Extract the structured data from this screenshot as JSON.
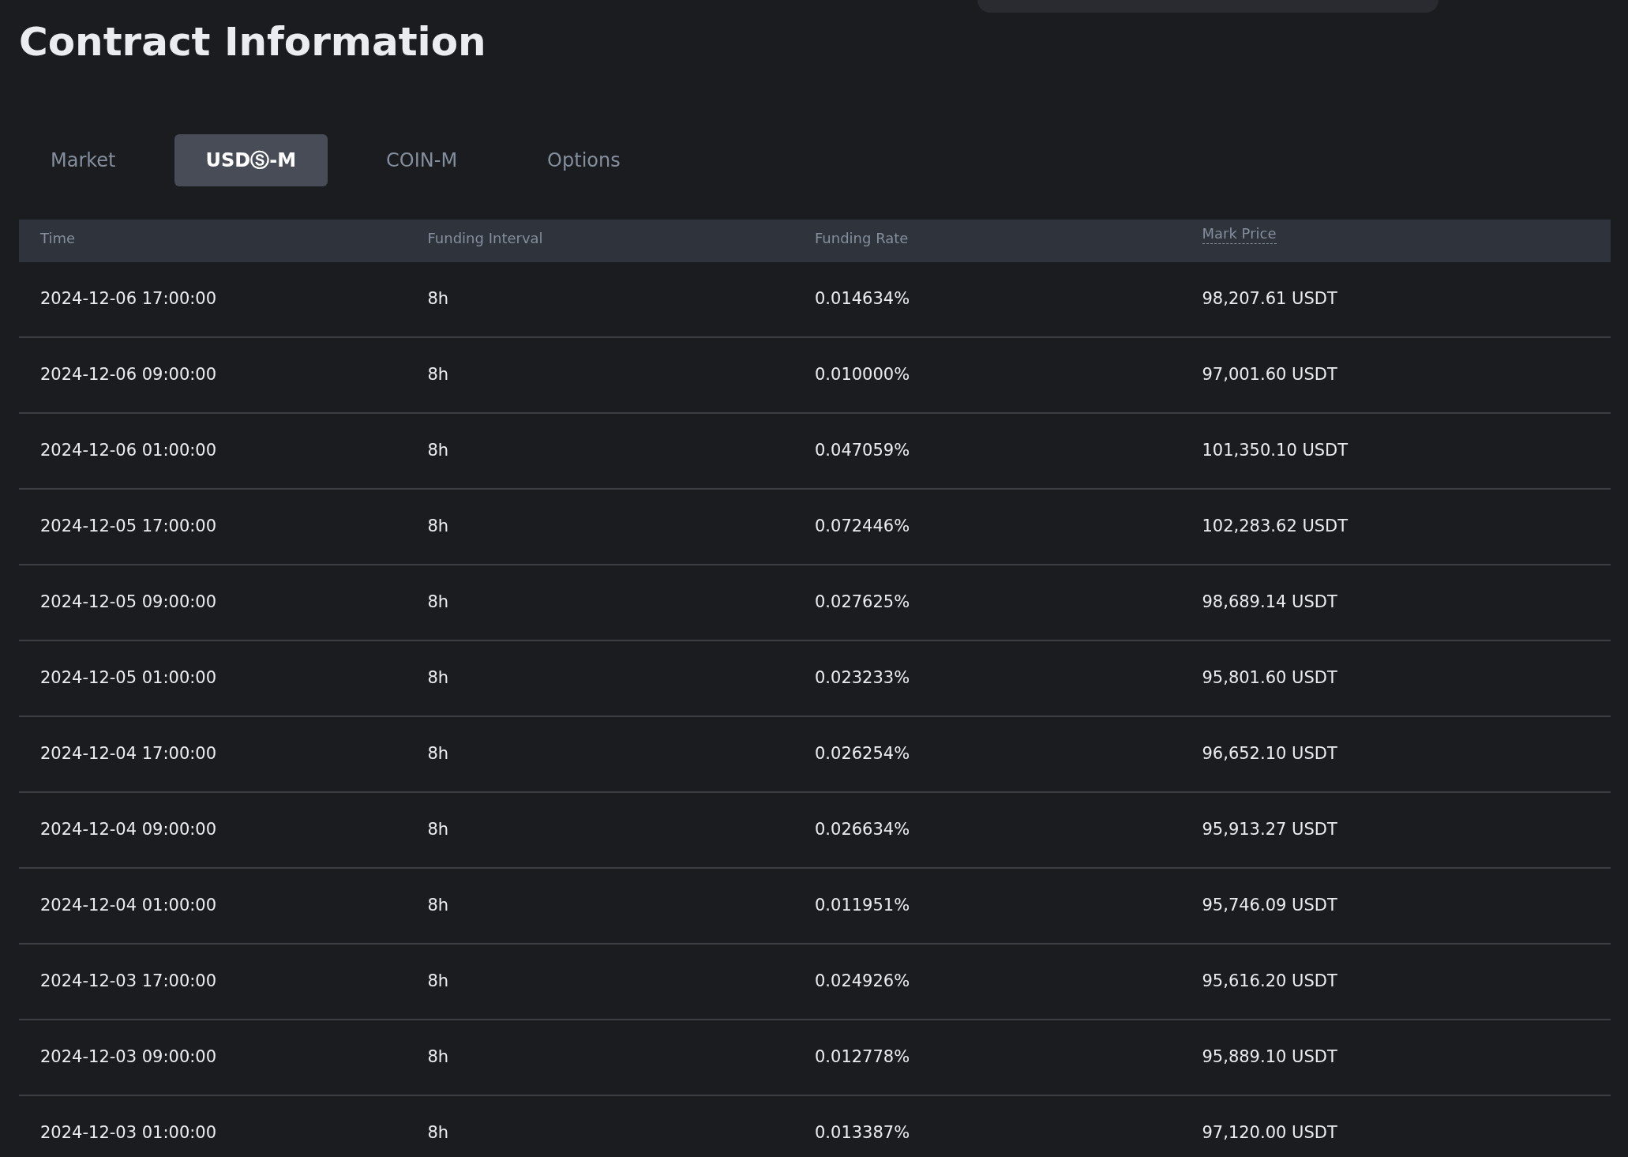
{
  "title": "Contract Information",
  "tabs": [
    {
      "label": "Market",
      "selected": false
    },
    {
      "label": "USDⓈ-M",
      "selected": true
    },
    {
      "label": "COIN-M",
      "selected": false
    },
    {
      "label": "Options",
      "selected": false
    }
  ],
  "table": {
    "columns": [
      "Time",
      "Funding Interval",
      "Funding Rate",
      "Mark Price"
    ],
    "rows": [
      [
        "2024-12-06 17:00:00",
        "8h",
        "0.014634%",
        "98,207.61 USDT"
      ],
      [
        "2024-12-06 09:00:00",
        "8h",
        "0.010000%",
        "97,001.60 USDT"
      ],
      [
        "2024-12-06 01:00:00",
        "8h",
        "0.047059%",
        "101,350.10 USDT"
      ],
      [
        "2024-12-05 17:00:00",
        "8h",
        "0.072446%",
        "102,283.62 USDT"
      ],
      [
        "2024-12-05 09:00:00",
        "8h",
        "0.027625%",
        "98,689.14 USDT"
      ],
      [
        "2024-12-05 01:00:00",
        "8h",
        "0.023233%",
        "95,801.60 USDT"
      ],
      [
        "2024-12-04 17:00:00",
        "8h",
        "0.026254%",
        "96,652.10 USDT"
      ],
      [
        "2024-12-04 09:00:00",
        "8h",
        "0.026634%",
        "95,913.27 USDT"
      ],
      [
        "2024-12-04 01:00:00",
        "8h",
        "0.011951%",
        "95,746.09 USDT"
      ],
      [
        "2024-12-03 17:00:00",
        "8h",
        "0.024926%",
        "95,616.20 USDT"
      ],
      [
        "2024-12-03 09:00:00",
        "8h",
        "0.012778%",
        "95,889.10 USDT"
      ],
      [
        "2024-12-03 01:00:00",
        "8h",
        "0.013387%",
        "97,120.00 USDT"
      ]
    ]
  }
}
